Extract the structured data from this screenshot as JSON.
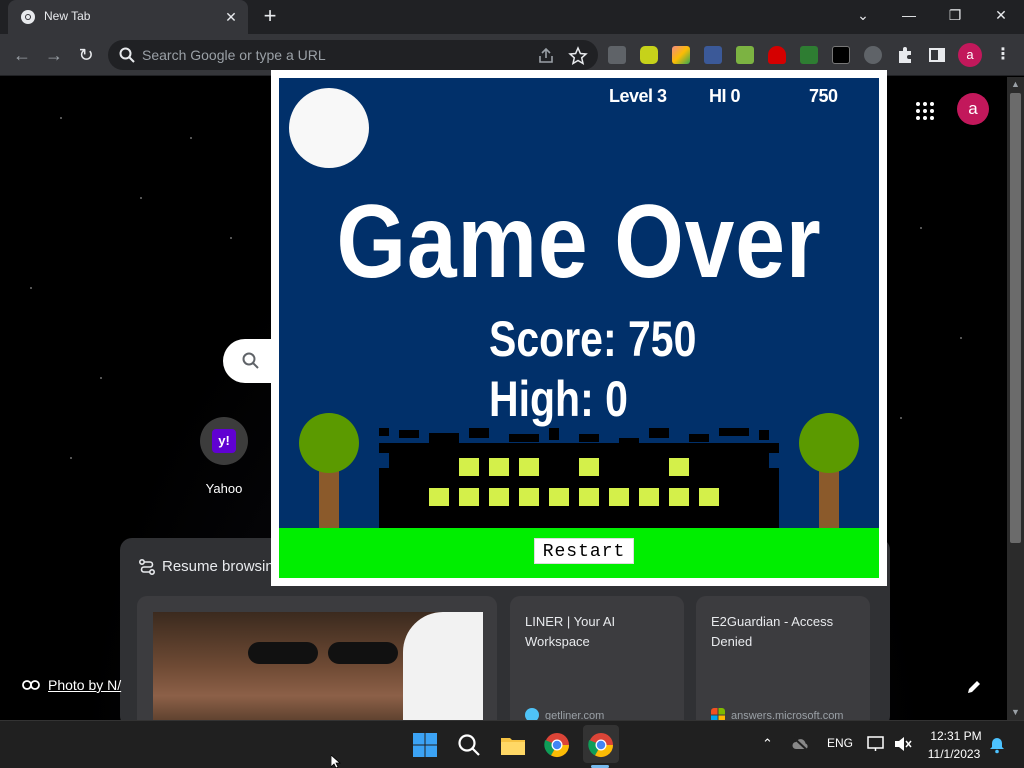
{
  "browser": {
    "tab_title": "New Tab",
    "omnibox_placeholder": "Search Google or type a URL",
    "profile_initial": "a"
  },
  "ntp": {
    "account_initial": "a",
    "shortcuts": [
      {
        "label": "Yahoo",
        "icon": "y!"
      }
    ],
    "resume_title": "Resume browsin",
    "cards": [
      {
        "title": "",
        "domain": ""
      },
      {
        "title": "LINER | Your AI Workspace",
        "domain": "getliner.com"
      },
      {
        "title": "E2Guardian - Access Denied",
        "domain": "answers.microsoft.com"
      }
    ],
    "photo_credit": "Photo by N/"
  },
  "game": {
    "level": "Level 3",
    "hi": "HI 0",
    "score_hud": "750",
    "title": "Game Over",
    "score_line": "Score: 750",
    "high_line": "High: 0",
    "restart": "Restart",
    "colors": {
      "sky": "#01306a",
      "ground": "#00ee00",
      "window": "#d4f04a",
      "tree": "#5b9a00",
      "trunk": "#8b5a2b"
    }
  },
  "taskbar": {
    "language": "ENG",
    "time": "12:31 PM",
    "date": "11/1/2023"
  }
}
